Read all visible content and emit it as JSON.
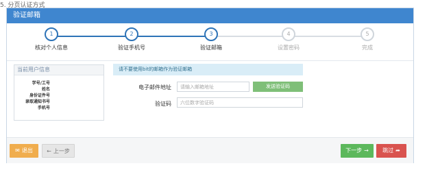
{
  "top_text": "5.  分页认证方式",
  "header": {
    "title": "验证邮箱"
  },
  "steps": [
    {
      "num": "1",
      "label": "核对个人信息",
      "state": "active"
    },
    {
      "num": "2",
      "label": "验证手机号",
      "state": "active"
    },
    {
      "num": "3",
      "label": "验证邮箱",
      "state": "active"
    },
    {
      "num": "4",
      "label": "设置密码",
      "state": "todo"
    },
    {
      "num": "5",
      "label": "完成",
      "state": "todo"
    }
  ],
  "user_info": {
    "title": "当前用户信息",
    "fields": [
      "学号/工号",
      "姓名",
      "身份证件号",
      "录取通知书号",
      "手机号"
    ]
  },
  "notice": "请不要使用bit的邮箱作为验证邮箱",
  "form": {
    "email_label": "电子邮件地址",
    "email_placeholder": "请输入邮箱地址",
    "send_button": "发送验证码",
    "code_label": "验证码",
    "code_placeholder": "六位数字验证码"
  },
  "footer": {
    "exit_label": "退出",
    "prev_label": "上一步",
    "next_label": "下一步",
    "skip_label": "跳过"
  },
  "colors": {
    "header": "#3f86cf",
    "step_active": "#2d73b7",
    "notice_bg": "#d9edf7",
    "send": "#7fbf78",
    "exit": "#f0ad4e",
    "next": "#5cb85c",
    "skip": "#d9534f"
  },
  "icons": [
    "envelope-icon",
    "arrow-left-icon",
    "arrow-right-icon",
    "share-icon"
  ]
}
